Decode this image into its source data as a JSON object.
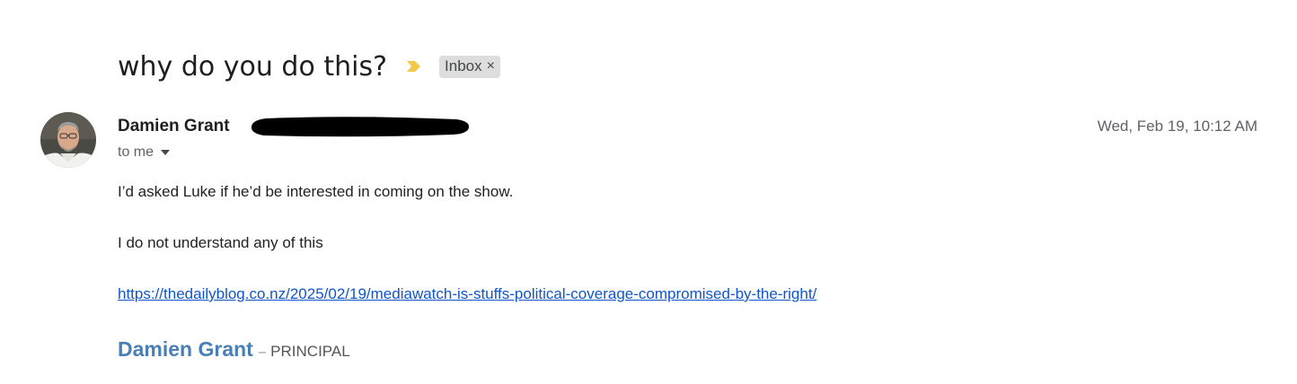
{
  "email": {
    "subject": "why do you do this?",
    "importance_icon": "importance-marker-icon",
    "label": {
      "name": "Inbox",
      "remove_glyph": "×"
    },
    "sender": {
      "name": "Damien Grant",
      "address_redacted": true,
      "avatar_icon": "avatar"
    },
    "recipients": "to me",
    "timestamp": "Wed, Feb 19, 10:12 AM",
    "body": {
      "line1": "I’d asked Luke if he’d be interested in coming on the show.",
      "line2": "I do not understand any of this",
      "link": "https://thedailyblog.co.nz/2025/02/19/mediawatch-is-stuffs-political-coverage-compromised-by-the-right/"
    },
    "signature": {
      "name": "Damien Grant",
      "dash": "–",
      "title": "PRINCIPAL"
    }
  },
  "colors": {
    "importance_marker": "#f2c94c",
    "link": "#1155cc",
    "signature_name": "#4a7fb5",
    "label_chip_bg": "#dddddd"
  }
}
